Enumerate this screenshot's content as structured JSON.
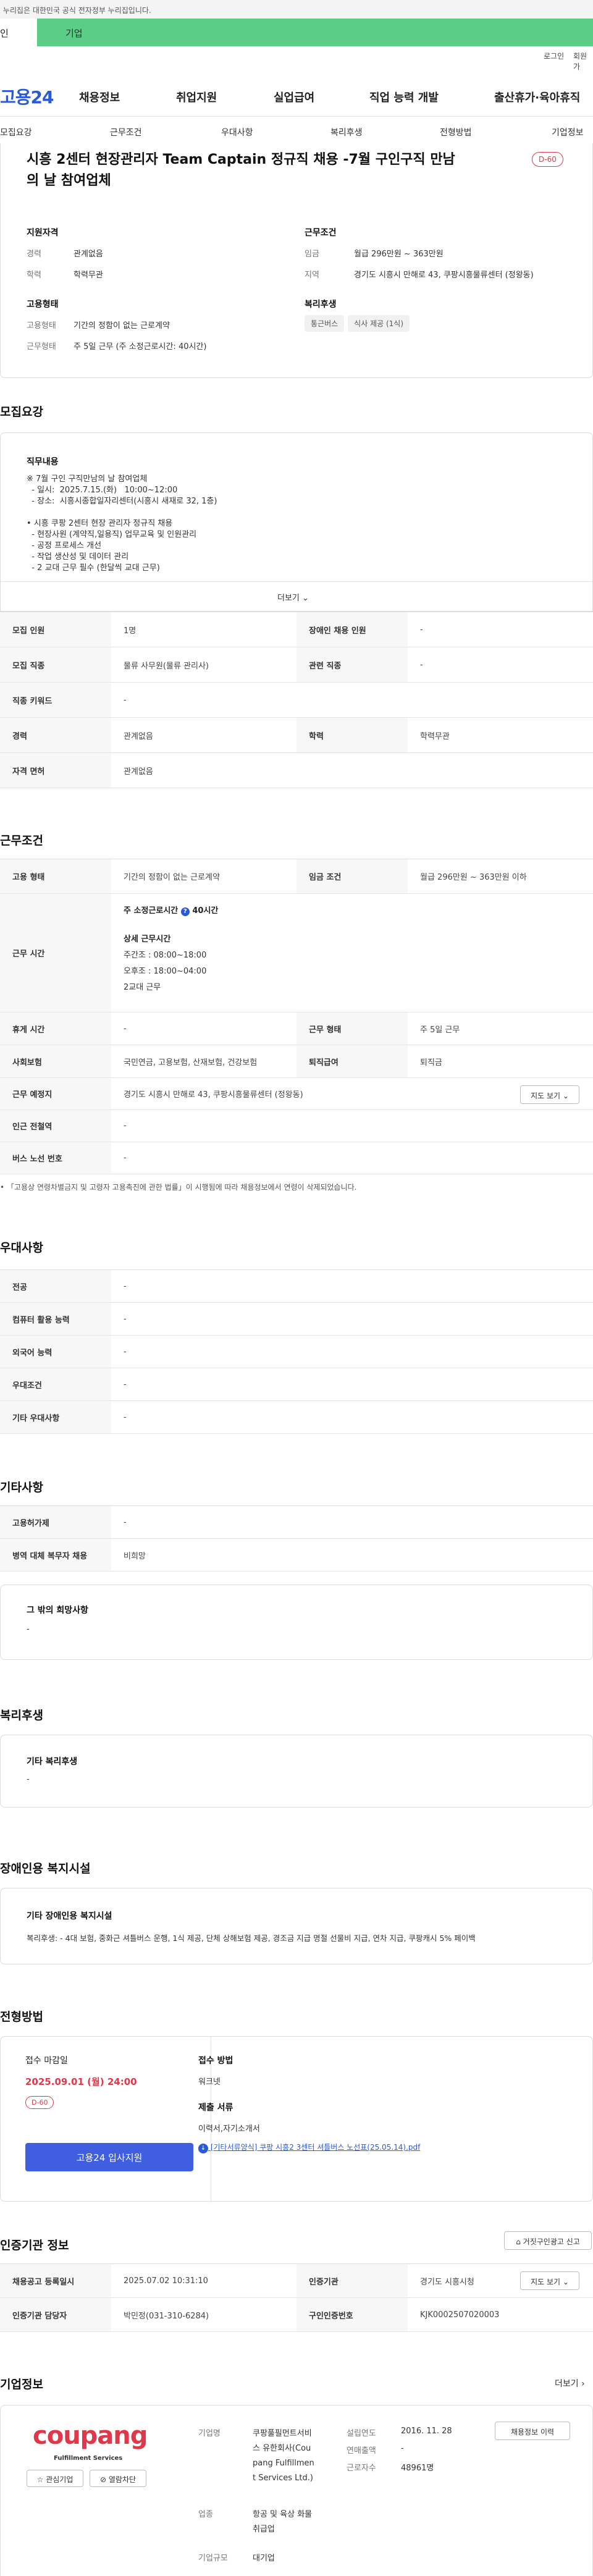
{
  "gov_banner": "이 누리집은 대한민국 공식 전자정부 누리집입니다.",
  "user_tabs": {
    "personal": "인",
    "corporate": "기업"
  },
  "util_links": {
    "login": "로그인",
    "signup": "회원가"
  },
  "logo": "고용24",
  "gnb": [
    "채용정보",
    "취업지원",
    "실업급여",
    "직업 능력 개발",
    "출산휴가·육아휴직"
  ],
  "lnb": [
    "모집요강",
    "근무조건",
    "우대사항",
    "복리후생",
    "전형방법",
    "기업정보"
  ],
  "header_card": {
    "title_line1": "시흥 2센터 현장관리자 Team Captain 정규직 채용 -7월 구인구직 만남",
    "title_line2": "의 날 참여업체",
    "dday": "D-60",
    "qual_head": "지원자격",
    "cond_head": "근무조건",
    "qual": [
      {
        "label": "경력",
        "value": "관계없음"
      },
      {
        "label": "학력",
        "value": "학력무관"
      }
    ],
    "cond": [
      {
        "label": "임금",
        "value": "월급 296만원 ~ 363만원"
      },
      {
        "label": "지역",
        "value": "경기도 시흥시 만해로 43, 쿠팡시흥물류센터 (정왕동)"
      }
    ],
    "emp_head": "고용형태",
    "emp": [
      {
        "label": "고용형태",
        "value": "기간의 정함이 없는 근로계약"
      },
      {
        "label": "근무형태",
        "value": "주 5일 근무 (주 소정근로시간: 40시간)"
      }
    ],
    "welfare_head": "복리후생",
    "welfare_chips": [
      "통근버스",
      "식사 제공 (1식)"
    ]
  },
  "recruit": {
    "title": "모집요강",
    "duty_head": "직무내용",
    "duty_text": "※ 7월 구인 구직만남의 날 참여업체\n  - 일시:  2025.7.15.(화)   10:00~12:00\n  - 장소:  시흥시종합일자리센터(시흥시 새재로 32, 1층)\n\n• 시흥 쿠팡 2센터 현장 관리자 정규직 채용\n  - 현장사원 (계약직,일용직) 업무교육 및 인원관리\n  - 공정 프로세스 개선\n  - 작업 생산성 및 데이터 관리\n  - 2 교대 근무 필수 (한달씩 교대 근무)",
    "more": "더보기",
    "rows": [
      {
        "k1": "모집 인원",
        "v1": "1명",
        "k2": "장애인 채용 인원",
        "v2": "-"
      },
      {
        "k1": "모집 직종",
        "v1": "물류 사무원(물류 관리사)",
        "k2": "관련 직종",
        "v2": "-"
      },
      {
        "k1": "직종 키워드",
        "v1": "-"
      },
      {
        "k1": "경력",
        "v1": "관계없음",
        "k2": "학력",
        "v2": "학력무관"
      },
      {
        "k1": "자격 면허",
        "v1": "관계없음"
      }
    ]
  },
  "conditions": {
    "title": "근무조건",
    "emp_type_label": "고용 형태",
    "emp_type": "기간의 정함이 없는 근로계약",
    "wage_label": "임금 조건",
    "wage": "월급 296만원 ~ 363만원 이하",
    "hours_label": "근무 시간",
    "hours_weekly": "주 소정근로시간",
    "hours_weekly_val": "40시간",
    "hours_detail_head": "상세 근무시간",
    "hours_detail": [
      "주간조 : 08:00~18:00",
      "오후조 : 18:00~04:00",
      "2교대 근무"
    ],
    "rest_label": "휴게 시간",
    "rest": "-",
    "worktype_label": "근무 형태",
    "worktype": "주 5일 근무",
    "insurance_label": "사회보험",
    "insurance": "국민연금, 고용보험, 산재보험, 건강보험",
    "retire_label": "퇴직급여",
    "retire": "퇴직금",
    "place_label": "근무 예정지",
    "place": "경기도 시흥시 만해로 43, 쿠팡시흥물류센터 (정왕동)",
    "map_btn": "지도 보기",
    "subway_label": "인근 전철역",
    "subway": "-",
    "bus_label": "버스 노선 번호",
    "bus": "-",
    "note": "「고용상 연령차별금지 및 고령자 고용촉진에 관한 법률」이 시행됨에 따라 채용정보에서 연령이 삭제되었습니다."
  },
  "preference": {
    "title": "우대사항",
    "rows": [
      {
        "k": "전공",
        "v": "-"
      },
      {
        "k": "컴퓨터 활용 능력",
        "v": "-"
      },
      {
        "k": "외국어 능력",
        "v": "-"
      },
      {
        "k": "우대조건",
        "v": "-"
      },
      {
        "k": "기타 우대사항",
        "v": "-"
      }
    ]
  },
  "etc": {
    "title": "기타사항",
    "rows": [
      {
        "k": "고용허가제",
        "v": "-"
      },
      {
        "k": "병역 대체 복무자 채용",
        "v": "비희망"
      }
    ],
    "other_head": "그 밖의 희망사항",
    "other_val": "-"
  },
  "welfare": {
    "title": "복리후생",
    "head": "기타 복리후생",
    "val": "-"
  },
  "disability": {
    "title": "장애인용 복지시설",
    "head": "기타 장애인용 복지시설",
    "val": "복리후생: - 4대 보험, 중화근 셔틀버스 운행, 1식 제공, 단체 상해보험 제공, 경조금 지급 명절 선물비 지급, 연차 지급, 쿠팡캐시 5% 페이백"
  },
  "selection": {
    "title": "전형방법",
    "deadline_head": "접수 마감일",
    "deadline": "2025.09.01 (월) 24:00",
    "dday": "D-60",
    "apply_btn": "고용24 입사지원",
    "method_head": "접수 방법",
    "method": "워크넷",
    "docs_head": "제출 서류",
    "docs": "이력서,자기소개서",
    "file": "[기타서류양식] 쿠팡 시흥2 3센터 셔틀버스 노선표(25.05.14).pdf"
  },
  "cert": {
    "title": "인증기관 정보",
    "report_btn": "거짓구인광고 신고",
    "rows": [
      {
        "k1": "채용공고 등록일시",
        "v1": "2025.07.02 10:31:10",
        "k2": "인증기관",
        "v2": "경기도 시흥시청"
      },
      {
        "k1": "인증기관 담당자",
        "v1": "박민정(031-310-6284)",
        "k2": "구인인증번호",
        "v2": "KJK0002507020003"
      }
    ],
    "map_btn": "지도 보기"
  },
  "company": {
    "title": "기업정보",
    "more": "더보기",
    "logo_text": "coupang",
    "logo_sub": "Fulfillment Services",
    "fav_btn": "관심기업",
    "block_btn": "열람차단",
    "name_label": "기업명",
    "name": "쿠팡풀필먼트서비\n스 유한회사(Cou\npang Fulfillmen\nt Services Ltd.)",
    "industry_label": "업종",
    "industry": "항공 및 육상 화물\n취급업",
    "size_label": "기업규모",
    "size": "대기업",
    "founded_label": "설립연도",
    "founded": "2016. 11. 28",
    "revenue_label": "연매출액",
    "revenue": "-",
    "employees_label": "근로자수",
    "employees": "48961명",
    "hire_info_btn": "채용정보 이력"
  }
}
